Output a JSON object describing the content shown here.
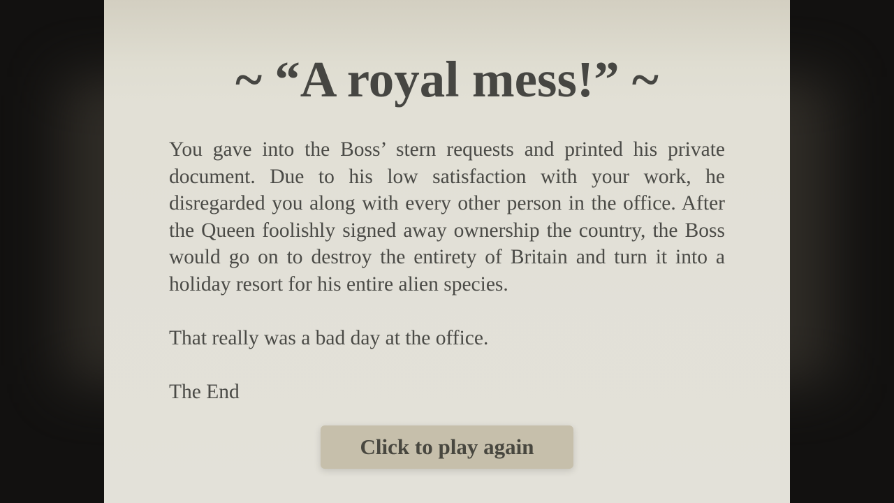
{
  "ending": {
    "title": "~ “A royal mess!” ~",
    "paragraphs": [
      "You gave into the Boss’ stern requests and printed his private document. Due to his low satisfaction with your work, he disregarded you along with every other person in the office. After the Queen foolishly signed away ownership the country, the Boss would go on to destroy the entirety of Britain and turn it into a holiday resort for his entire alien species.",
      "That really was a bad day at the office.",
      "The End"
    ]
  },
  "button": {
    "label": "Click to play again"
  },
  "colors": {
    "background": "#121110",
    "page": "#e3e1d9",
    "text": "#4a4a46",
    "button": "#c6bfab"
  }
}
